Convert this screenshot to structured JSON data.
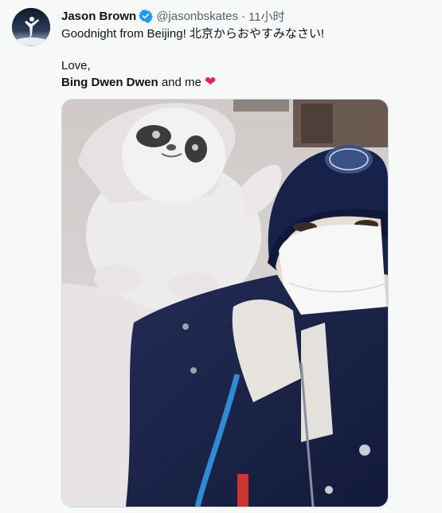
{
  "tweet": {
    "author_name": "Jason Brown",
    "handle": "@jasonbskates",
    "separator": "·",
    "time": "11小时",
    "line1": "Goodnight from Beijing! 北京からおやすみなさい!",
    "line2": "Love,",
    "line3_bold": "Bing Dwen Dwen",
    "line3_rest": " and me ",
    "heart": "❤"
  },
  "colors": {
    "verified_badge": "#1d9bf0",
    "heart": "#e0245e",
    "secondary_text": "#536471"
  },
  "icons": {
    "verified": "verified-badge-icon"
  }
}
